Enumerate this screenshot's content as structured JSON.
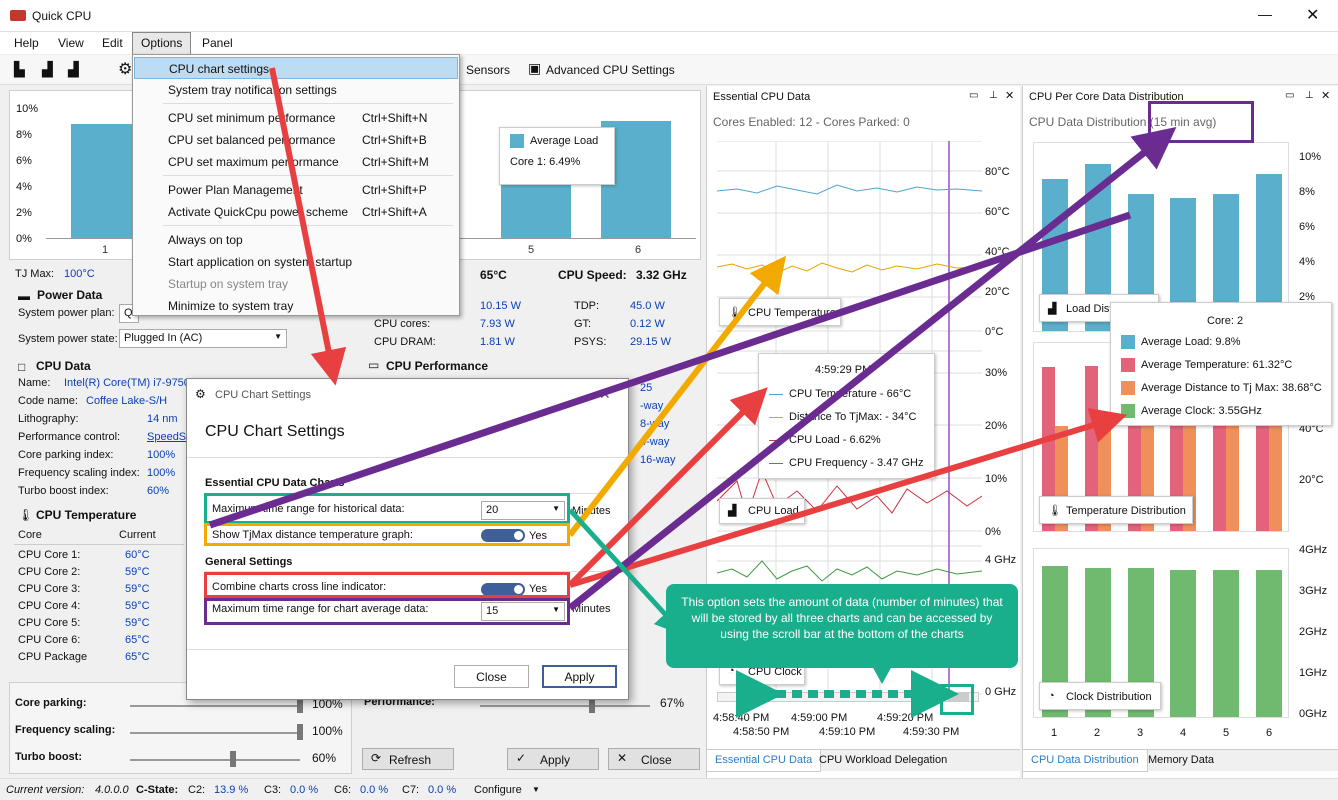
{
  "app": {
    "title": "Quick CPU"
  },
  "menu": {
    "help": "Help",
    "view": "View",
    "edit": "Edit",
    "options": "Options",
    "panel": "Panel"
  },
  "toolbar": {
    "sensors": "Sensors",
    "advanced": "Advanced CPU Settings"
  },
  "options_menu": [
    {
      "label": "CPU chart settings",
      "shortcut": ""
    },
    {
      "label": "System tray notification settings",
      "shortcut": ""
    },
    {
      "label": "CPU set minimum performance",
      "shortcut": "Ctrl+Shift+N"
    },
    {
      "label": "CPU set balanced performance",
      "shortcut": "Ctrl+Shift+B"
    },
    {
      "label": "CPU set maximum performance",
      "shortcut": "Ctrl+Shift+M"
    },
    {
      "label": "Power Plan Management",
      "shortcut": "Ctrl+Shift+P"
    },
    {
      "label": "Activate QuickCpu power scheme",
      "shortcut": "Ctrl+Shift+A"
    },
    {
      "label": "Always on top",
      "shortcut": ""
    },
    {
      "label": "Start application on system startup",
      "shortcut": ""
    },
    {
      "label": "Startup on system tray",
      "shortcut": ""
    },
    {
      "label": "Minimize to system tray",
      "shortcut": ""
    }
  ],
  "left_chart": {
    "yticks": [
      "10%",
      "8%",
      "6%",
      "4%",
      "2%",
      "0%"
    ],
    "xticks": [
      "1",
      "5",
      "6"
    ],
    "legend": "Average Load",
    "tooltip": "Core 1:  6.49%"
  },
  "tjmax": {
    "label": "TJ Max:",
    "value": "100°C"
  },
  "cpu_temp_big": "65°C",
  "cpu_speed": {
    "label": "CPU Speed:",
    "value": "3.32 GHz"
  },
  "power": {
    "title": "Power Data",
    "plan_label": "System power plan:",
    "plan_value": "Q",
    "state_label": "System power state:",
    "state_value": "Plugged In (AC)"
  },
  "power_vals": [
    {
      "l": "",
      "v": "10.15 W",
      "l2": "TDP:",
      "v2": "45.0 W"
    },
    {
      "l": "CPU cores:",
      "v": "7.93 W",
      "l2": "GT:",
      "v2": "0.12 W"
    },
    {
      "l": "CPU DRAM:",
      "v": "1.81 W",
      "l2": "PSYS:",
      "v2": "29.15 W"
    }
  ],
  "cpu_data": {
    "title": "CPU Data",
    "rows": [
      {
        "l": "Name:",
        "v": "Intel(R) Core(TM) i7-9750"
      },
      {
        "l": "Code name:",
        "v": "Coffee Lake-S/H"
      },
      {
        "l": "Lithography:",
        "v": "14 nm"
      },
      {
        "l": "Performance control:",
        "v": "SpeedS"
      },
      {
        "l": "Core parking index:",
        "v": "100%"
      },
      {
        "l": "Frequency scaling index:",
        "v": "100%"
      },
      {
        "l": "Turbo boost index:",
        "v": "60%"
      }
    ]
  },
  "cpu_perf": {
    "title": "CPU Performance",
    "vals": [
      "25",
      "-way",
      "8-way",
      "4-way",
      "16-way"
    ]
  },
  "cpu_temp": {
    "title": "CPU Temperature",
    "col1": "Core",
    "col2": "Current",
    "rows": [
      {
        "c": "CPU Core 1:",
        "v": "60°C"
      },
      {
        "c": "CPU Core 2:",
        "v": "59°C"
      },
      {
        "c": "CPU Core 3:",
        "v": "59°C"
      },
      {
        "c": "CPU Core 4:",
        "v": "59°C"
      },
      {
        "c": "CPU Core 5:",
        "v": "59°C"
      },
      {
        "c": "CPU Core 6:",
        "v": "65°C"
      },
      {
        "c": "CPU Package",
        "v": "65°C"
      }
    ]
  },
  "sliders": [
    {
      "l": "Core parking:",
      "v": "100%"
    },
    {
      "l": "Frequency scaling:",
      "v": "100%"
    },
    {
      "l": "Turbo boost:",
      "v": "60%"
    }
  ],
  "perf_slider": {
    "l": "Performance:",
    "v": "67%"
  },
  "bottom_buttons": {
    "refresh": "Refresh",
    "apply": "Apply",
    "close": "Close"
  },
  "status": {
    "version_label": "Current version:",
    "version": "4.0.0.0",
    "cstate": "C-State:",
    "c2l": "C2:",
    "c2": "13.9 %",
    "c3l": "C3:",
    "c3": "0.0 %",
    "c6l": "C6:",
    "c6": "0.0 %",
    "c7l": "C7:",
    "c7": "0.0 %",
    "configure": "Configure"
  },
  "dialog": {
    "titlebar": "CPU Chart Settings",
    "heading": "CPU Chart Settings",
    "sec1": "Essential CPU Data Charts",
    "max_hist_label": "Maximum time range for historical data:",
    "max_hist_value": "20",
    "minutes": "Minutes",
    "tjmax_label": "Show TjMax distance temperature graph:",
    "yes": "Yes",
    "sec2": "General Settings",
    "cross_label": "Combine charts cross line indicator:",
    "avg_label": "Maximum time range for chart average data:",
    "avg_value": "15",
    "close": "Close",
    "apply": "Apply"
  },
  "essential": {
    "title": "Essential CPU Data",
    "cores": "Cores Enabled: 12 - Cores Parked: 0",
    "temp_ticks": [
      "80°C",
      "60°C",
      "40°C",
      "20°C",
      "0°C"
    ],
    "load_ticks": [
      "30%",
      "20%",
      "10%",
      "0%"
    ],
    "clock_ticks": [
      "4 GHz",
      "0 GHz"
    ],
    "temp_btn": "CPU Temperature",
    "load_btn": "CPU Load",
    "clock_btn": "CPU Clock",
    "times": [
      "4:58:40 PM",
      "4:59:00 PM",
      "4:59:20 PM",
      "4:58:50 PM",
      "4:59:10 PM",
      "4:59:30 PM"
    ],
    "tip_time": "4:59:29 PM",
    "tip_rows": [
      "CPU Temperature - 66°C",
      "Distance To TjMax: - 34°C",
      "CPU Load - 6.62%",
      "CPU Frequency - 3.47 GHz"
    ]
  },
  "callout": "This option sets the amount of data (number of minutes) that will be stored by all three charts and can be accessed by using the scroll bar at the bottom of the charts",
  "dist": {
    "title": "CPU Per Core Data Distribution",
    "subtitle": "CPU Data Distribution (15 min avg)",
    "load_ticks": [
      "10%",
      "8%",
      "6%",
      "4%",
      "2%"
    ],
    "temp_ticks": [
      "40°C",
      "20°C"
    ],
    "clock_ticks": [
      "4GHz",
      "3GHz",
      "2GHz",
      "1GHz",
      "0GHz"
    ],
    "xticks": [
      "1",
      "2",
      "3",
      "4",
      "5",
      "6"
    ],
    "load_btn": "Load Distr",
    "temp_btn": "Temperature Distribution",
    "clock_btn": "Clock Distribution",
    "tip_core": "Core: 2",
    "tip_rows": [
      "Average Load:  9.8%",
      "Average Temperature:  61.32°C",
      "Average Distance to Tj Max:  38.68°C",
      "Average Clock:  3.55GHz"
    ]
  },
  "tabs": {
    "t1": "Essential CPU Data",
    "t2": "CPU Workload Delegation",
    "t3": "CPU Data Distribution",
    "t4": "Memory Data"
  },
  "colors": {
    "load": "#5ab0cc",
    "temp": "#e2637a",
    "dist": "#ef8f5a",
    "clock": "#6fba6e",
    "callout": "#1aaf8c"
  },
  "chart_data": [
    {
      "type": "bar",
      "title": "",
      "categories": [
        "1",
        "2",
        "3",
        "4",
        "5",
        "6"
      ],
      "series": [
        {
          "name": "Average Load",
          "values": [
            8.9,
            9.8,
            8.0,
            7.8,
            8.0,
            9.2
          ]
        }
      ],
      "ylim": [
        0,
        11
      ]
    },
    {
      "type": "bar",
      "categories": [
        "1",
        "2",
        "3",
        "4",
        "5",
        "6"
      ],
      "series": [
        {
          "name": "Average Temperature",
          "values": [
            61,
            61.3,
            59,
            59,
            59,
            61
          ]
        },
        {
          "name": "Average Distance to Tj Max",
          "values": [
            39,
            38.7,
            41,
            41,
            41,
            39
          ]
        }
      ],
      "ylim": [
        0,
        70
      ]
    },
    {
      "type": "bar",
      "categories": [
        "1",
        "2",
        "3",
        "4",
        "5",
        "6"
      ],
      "series": [
        {
          "name": "Average Clock",
          "values": [
            3.6,
            3.55,
            3.55,
            3.5,
            3.5,
            3.5
          ]
        }
      ],
      "ylim": [
        0,
        4
      ]
    }
  ]
}
